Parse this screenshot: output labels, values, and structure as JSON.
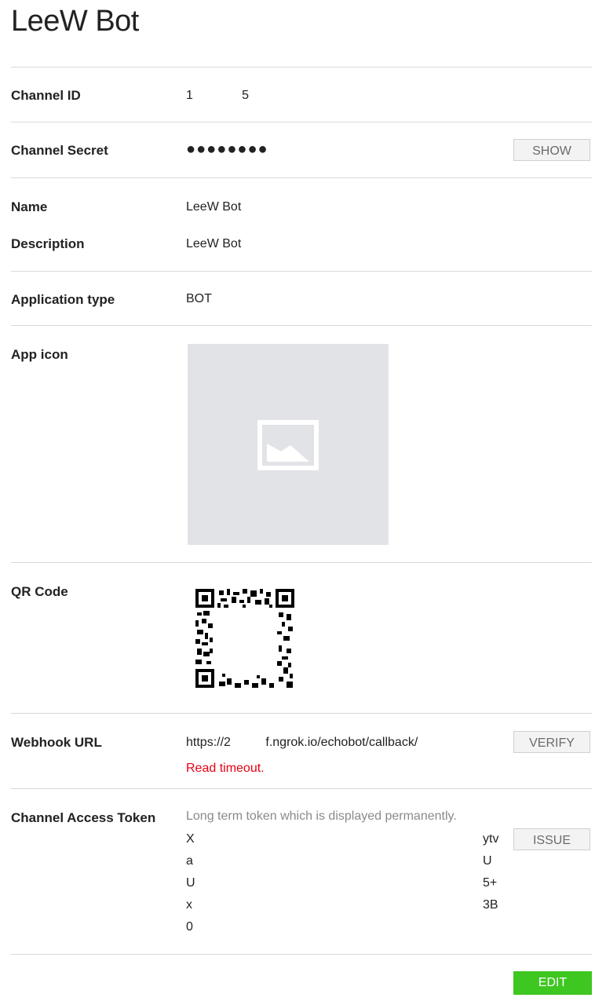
{
  "page": {
    "title": "LeeW Bot"
  },
  "channel_id": {
    "label": "Channel ID",
    "value": "1              5"
  },
  "channel_secret": {
    "label": "Channel Secret",
    "value": "●●●●●●●●",
    "button": "SHOW"
  },
  "name": {
    "label": "Name",
    "value": "LeeW Bot"
  },
  "description": {
    "label": "Description",
    "value": "LeeW Bot"
  },
  "application_type": {
    "label": "Application type",
    "value": "BOT"
  },
  "app_icon": {
    "label": "App icon",
    "icon": "image-placeholder-icon"
  },
  "qr_code": {
    "label": "QR Code",
    "icon": "qr-code-icon"
  },
  "webhook": {
    "label": "Webhook URL",
    "value": "https://2          f.ngrok.io/echobot/callback/",
    "error": "Read timeout.",
    "button": "VERIFY"
  },
  "access_token": {
    "label": "Channel Access Token",
    "hint": "Long term token which is displayed permanently.",
    "lines": [
      {
        "start": "X",
        "end": "ytv"
      },
      {
        "start": "a",
        "end": "U"
      },
      {
        "start": "U",
        "end": "5+"
      },
      {
        "start": "x",
        "end": "3B"
      },
      {
        "start": "0",
        "end": ""
      }
    ],
    "button": "ISSUE"
  },
  "footer": {
    "edit_button": "EDIT"
  },
  "colors": {
    "accent_green": "#3ec621",
    "error_red": "#e60012",
    "divider": "#d9d9d9"
  }
}
